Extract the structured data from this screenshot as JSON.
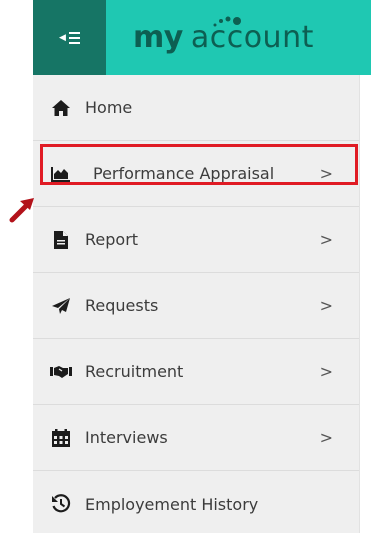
{
  "header": {
    "logo_my": "my",
    "logo_account": "account"
  },
  "sidebar": {
    "items": [
      {
        "label": "Home",
        "icon": "home-icon",
        "has_arrow": false
      },
      {
        "label": "Performance Appraisal",
        "icon": "area-chart-icon",
        "has_arrow": true
      },
      {
        "label": "Report",
        "icon": "file-icon",
        "has_arrow": true
      },
      {
        "label": "Requests",
        "icon": "paper-plane-icon",
        "has_arrow": true
      },
      {
        "label": "Recruitment",
        "icon": "handshake-icon",
        "has_arrow": true
      },
      {
        "label": "Interviews",
        "icon": "calendar-icon",
        "has_arrow": true
      },
      {
        "label": "Employement History",
        "icon": "history-icon",
        "has_arrow": false
      }
    ],
    "arrow_glyph": ">"
  },
  "colors": {
    "header_bg": "#1fc8b2",
    "toggle_bg": "#167565",
    "logo_text": "#0d5f52",
    "sidebar_bg": "#efefef",
    "highlight": "#e01b24"
  }
}
